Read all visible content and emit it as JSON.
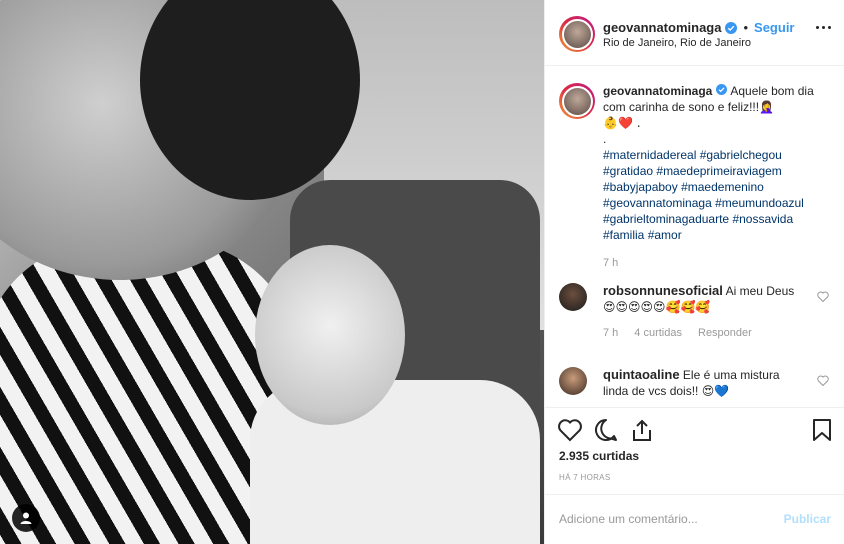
{
  "post": {
    "author": "geovannatominaga",
    "verified": true,
    "follow_label": "Seguir",
    "location": "Rio de Janeiro, Rio de Janeiro",
    "caption_text": "Aquele bom dia com carinha de sono e feliz!!!",
    "caption_emojis_1": "🤦‍♀️",
    "caption_emojis_2": "👶❤️ .",
    "caption_dot": ".",
    "hashtags": [
      "#maternidadereal",
      "#gabrielchegou",
      "#gratidao",
      "#maedeprimeiraviagem",
      "#babyjapaboy",
      "#maedemenino",
      "#geovannatominaga",
      "#meumundoazul",
      "#gabrieltominagaduarte",
      "#nossavida",
      "#familia",
      "#amor"
    ],
    "caption_time": "7 h"
  },
  "comments": [
    {
      "username": "robsonnunesoficial",
      "text": "Ai meu Deus",
      "emojis": "😍😍😍😍😍🥰🥰🥰",
      "time": "7 h",
      "likes": "4 curtidas",
      "reply_label": "Responder"
    },
    {
      "username": "quintaoaline",
      "text": "Ele é uma mistura linda de vcs dois!!",
      "emojis": "😍💙"
    }
  ],
  "actions": {
    "like_icon": "heart-icon",
    "comment_icon": "comment-icon",
    "share_icon": "share-icon",
    "save_icon": "bookmark-icon"
  },
  "likes_count": "2.935 curtidas",
  "posted_ago": "HÁ 7 HORAS",
  "add_comment": {
    "placeholder": "Adicione um comentário...",
    "publish_label": "Publicar"
  },
  "colors": {
    "link_blue": "#3897f0",
    "hashtag": "#003569",
    "muted": "#999999",
    "publish_disabled": "#b2dffc"
  }
}
